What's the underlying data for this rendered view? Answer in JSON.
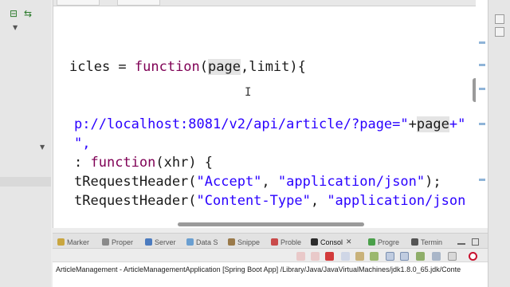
{
  "editor": {
    "lines": [
      {
        "segments": [
          {
            "text": "icles = ",
            "style": "plain"
          },
          {
            "text": "function",
            "style": "kw"
          },
          {
            "text": "(",
            "style": "plain"
          },
          {
            "text": "page",
            "style": "hl"
          },
          {
            "text": ",limit){",
            "style": "plain"
          }
        ]
      },
      {
        "segments": [
          {
            "text": "p://localhost:8081/v2/api/article/?page=\"",
            "style": "str"
          },
          {
            "text": "+",
            "style": "plain"
          },
          {
            "text": "page",
            "style": "hl"
          },
          {
            "text": "+\"",
            "style": "str"
          }
        ]
      },
      {
        "segments": [
          {
            "text": "\",",
            "style": "str"
          }
        ]
      },
      {
        "segments": [
          {
            "text": ": ",
            "style": "plain"
          },
          {
            "text": "function",
            "style": "kw"
          },
          {
            "text": "(xhr) {",
            "style": "plain"
          }
        ]
      },
      {
        "segments": [
          {
            "text": "tRequestHeader(",
            "style": "plain"
          },
          {
            "text": "\"Accept\"",
            "style": "str"
          },
          {
            "text": ", ",
            "style": "plain"
          },
          {
            "text": "\"application/json\"",
            "style": "str"
          },
          {
            "text": ");",
            "style": "plain"
          }
        ]
      },
      {
        "segments": [
          {
            "text": "tRequestHeader(",
            "style": "plain"
          },
          {
            "text": "\"Content-Type\"",
            "style": "str"
          },
          {
            "text": ", ",
            "style": "plain"
          },
          {
            "text": "\"application/json",
            "style": "str"
          }
        ]
      }
    ]
  },
  "bottom_tabs": [
    {
      "label": "Marker",
      "icon_color": "#c9a640"
    },
    {
      "label": "Proper",
      "icon_color": "#8a8a8a"
    },
    {
      "label": "Server",
      "icon_color": "#4b7bbf"
    },
    {
      "label": "Data S",
      "icon_color": "#6a9fd1"
    },
    {
      "label": "Snippe",
      "icon_color": "#9a7a4a"
    },
    {
      "label": "Proble",
      "icon_color": "#c94a4a"
    },
    {
      "label": "Consol",
      "icon_color": "#2c2c2c"
    },
    {
      "label": "Progre",
      "icon_color": "#4aa04a"
    },
    {
      "label": "Termin",
      "icon_color": "#555555"
    }
  ],
  "console": {
    "title": "ArticleManagement - ArticleManagementApplication [Spring Boot App] /Library/Java/JavaVirtualMachines/jdk1.8.0_65.jdk/Conte"
  },
  "icons": {
    "cursor": "I"
  }
}
